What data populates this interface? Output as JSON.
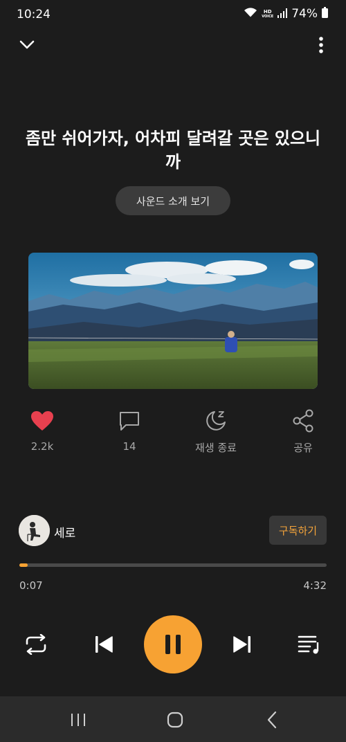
{
  "status_bar": {
    "time": "10:24",
    "hd_label": "HD",
    "voice_label": "VOICE",
    "battery": "74%",
    "icons": [
      "wifi-icon",
      "hd-voice-icon",
      "signal-icon",
      "battery-icon"
    ]
  },
  "track": {
    "title": "좀만 쉬어가자, 어차피 달려갈 곳은 있으니까",
    "intro_button": "사운드 소개 보기"
  },
  "actions": {
    "like": {
      "icon": "heart-icon",
      "label": "2.2k",
      "color": "#e8404f"
    },
    "comment": {
      "icon": "comment-icon",
      "label": "14"
    },
    "sleep": {
      "icon": "moon-sleep-icon",
      "label": "재생 종료"
    },
    "share": {
      "icon": "share-icon",
      "label": "공유"
    }
  },
  "artist": {
    "name": "세로",
    "subscribe": "구독하기"
  },
  "progress": {
    "current": "0:07",
    "total": "4:32",
    "fraction": 0.027
  },
  "controls": {
    "icons": [
      "repeat-icon",
      "previous-icon",
      "pause-icon",
      "next-icon",
      "queue-icon"
    ]
  },
  "colors": {
    "background": "#1c1c1c",
    "accent": "#f7a233",
    "like": "#e8404f"
  }
}
